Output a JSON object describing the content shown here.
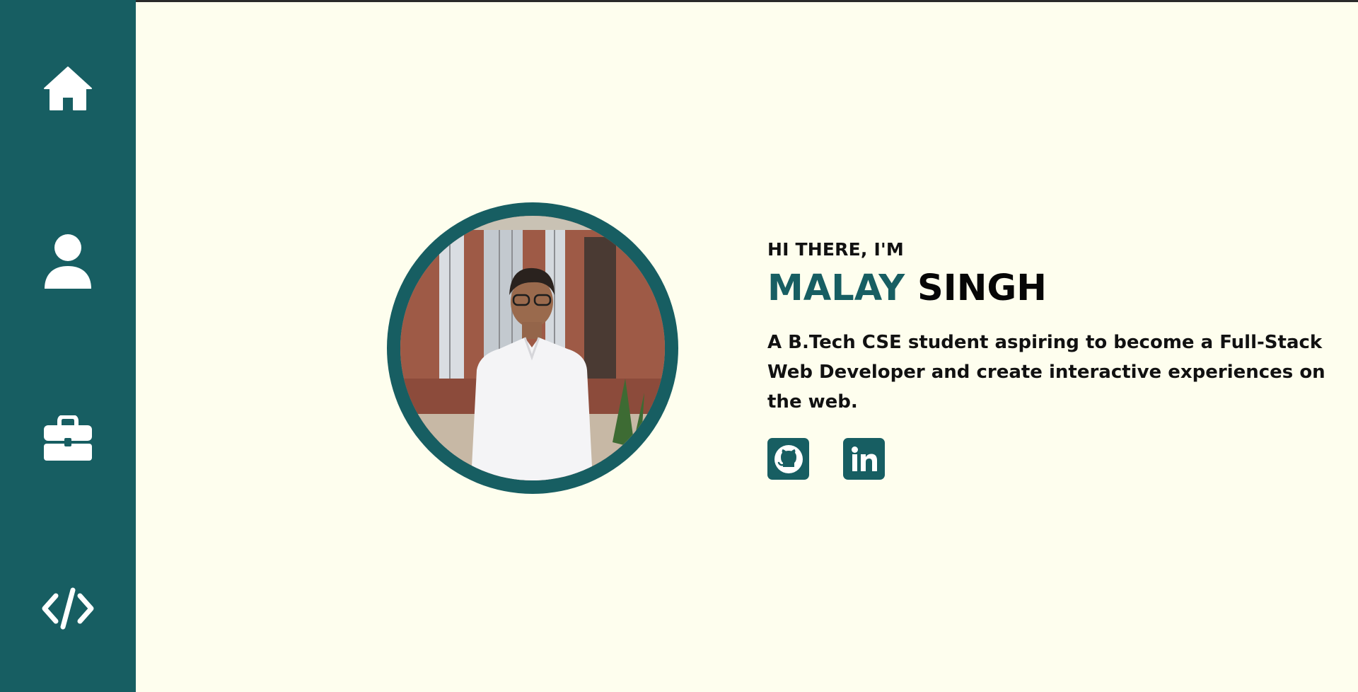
{
  "sidebar": {
    "items": [
      {
        "id": "home",
        "icon": "home-icon"
      },
      {
        "id": "about",
        "icon": "user-icon"
      },
      {
        "id": "work",
        "icon": "briefcase-icon"
      },
      {
        "id": "code",
        "icon": "code-icon"
      }
    ]
  },
  "hero": {
    "greeting": "HI THERE, I'M",
    "first_name": "MALAY",
    "last_name": "SINGH",
    "tagline": "A B.Tech CSE student aspiring to become a Full-Stack Web Developer and create interactive experiences on the web.",
    "photo_icon": "profile-photo"
  },
  "socials": [
    {
      "id": "github",
      "icon": "github-icon"
    },
    {
      "id": "linkedin",
      "icon": "linkedin-icon"
    }
  ],
  "colors": {
    "accent": "#175e62",
    "background": "#fefeee",
    "text": "#111111"
  }
}
